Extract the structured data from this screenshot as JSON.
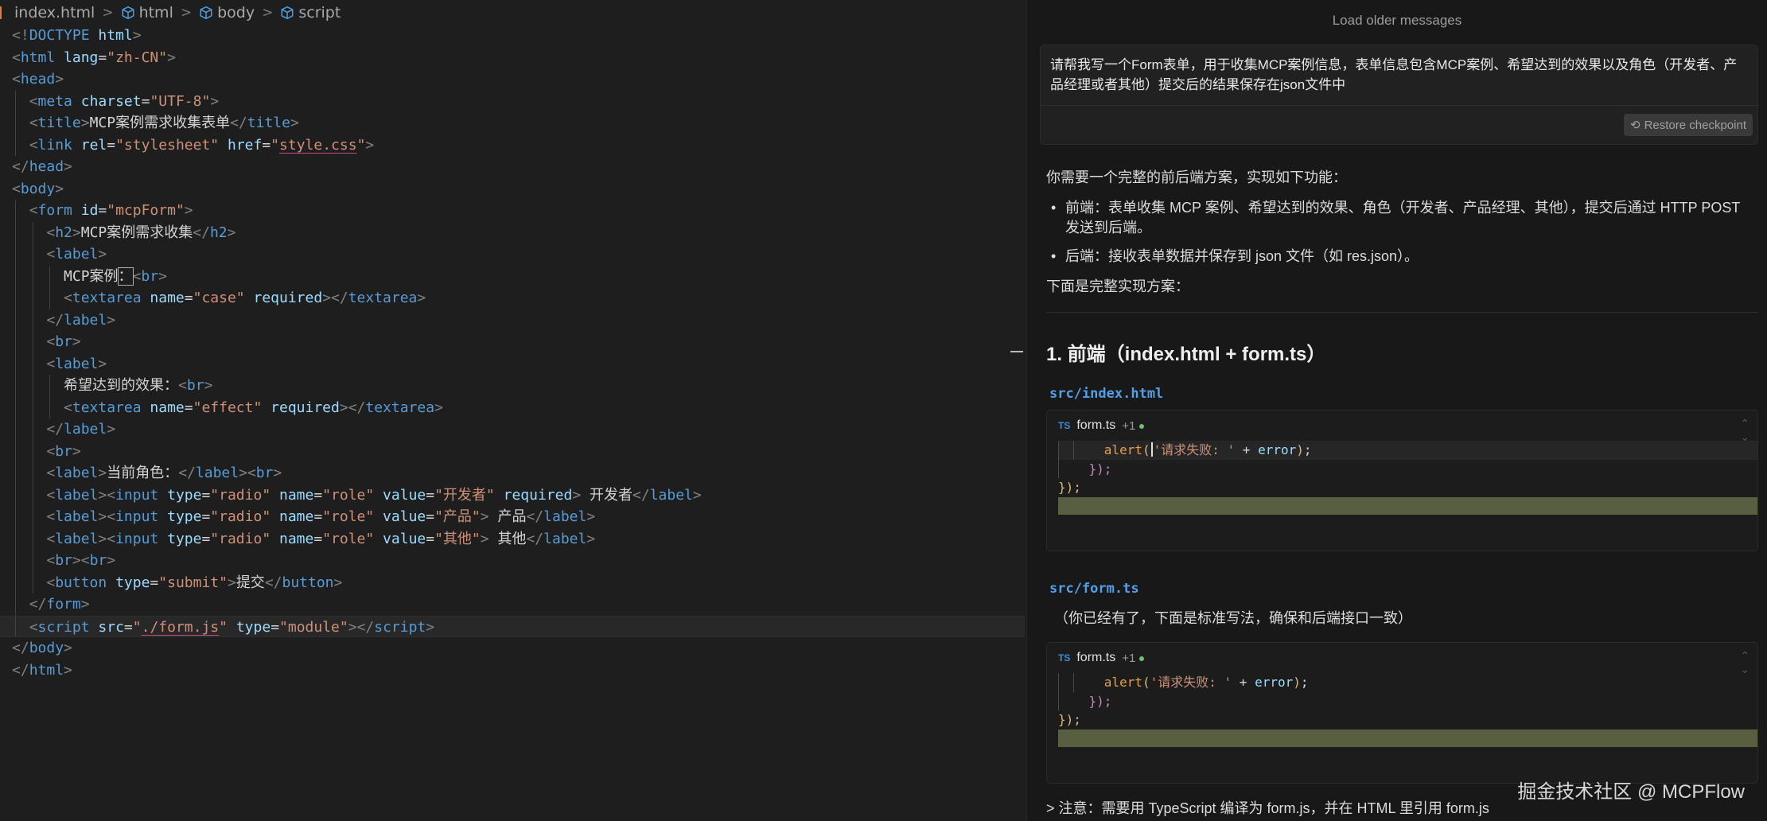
{
  "editor": {
    "breadcrumb": {
      "file": "index.html",
      "items": [
        "html",
        "body",
        "script"
      ]
    },
    "code_lines": [
      [
        {
          "c": "p",
          "t": "<!"
        },
        {
          "c": "t",
          "t": "DOCTYPE"
        },
        {
          "c": "a",
          "t": " html"
        },
        {
          "c": "p",
          "t": ">"
        }
      ],
      [
        {
          "c": "p",
          "t": "<"
        },
        {
          "c": "t",
          "t": "html"
        },
        {
          "c": "a",
          "t": " lang"
        },
        {
          "c": "tx",
          "t": "="
        },
        {
          "c": "s",
          "t": "\"zh-CN\""
        },
        {
          "c": "p",
          "t": ">"
        }
      ],
      [
        {
          "c": "p",
          "t": "<"
        },
        {
          "c": "t",
          "t": "head"
        },
        {
          "c": "p",
          "t": ">"
        }
      ],
      [
        {
          "c": "tx",
          "t": "  "
        },
        {
          "c": "p",
          "t": "<"
        },
        {
          "c": "t",
          "t": "meta"
        },
        {
          "c": "a",
          "t": " charset"
        },
        {
          "c": "tx",
          "t": "="
        },
        {
          "c": "s",
          "t": "\"UTF-8\""
        },
        {
          "c": "p",
          "t": ">"
        }
      ],
      [
        {
          "c": "tx",
          "t": "  "
        },
        {
          "c": "p",
          "t": "<"
        },
        {
          "c": "t",
          "t": "title"
        },
        {
          "c": "p",
          "t": ">"
        },
        {
          "c": "tx",
          "t": "MCP案例需求收集表单"
        },
        {
          "c": "p",
          "t": "</"
        },
        {
          "c": "t",
          "t": "title"
        },
        {
          "c": "p",
          "t": ">"
        }
      ],
      [
        {
          "c": "tx",
          "t": "  "
        },
        {
          "c": "p",
          "t": "<"
        },
        {
          "c": "t",
          "t": "link"
        },
        {
          "c": "a",
          "t": " rel"
        },
        {
          "c": "tx",
          "t": "="
        },
        {
          "c": "s",
          "t": "\"stylesheet\""
        },
        {
          "c": "a",
          "t": " href"
        },
        {
          "c": "tx",
          "t": "="
        },
        {
          "c": "s",
          "t": "\""
        },
        {
          "c": "s u",
          "t": "style.css"
        },
        {
          "c": "s",
          "t": "\""
        },
        {
          "c": "p",
          "t": ">"
        }
      ],
      [
        {
          "c": "p",
          "t": "</"
        },
        {
          "c": "t",
          "t": "head"
        },
        {
          "c": "p",
          "t": ">"
        }
      ],
      [
        {
          "c": "p",
          "t": "<"
        },
        {
          "c": "t",
          "t": "body"
        },
        {
          "c": "p",
          "t": ">"
        }
      ],
      [
        {
          "c": "tx",
          "t": "  "
        },
        {
          "c": "p",
          "t": "<"
        },
        {
          "c": "t",
          "t": "form"
        },
        {
          "c": "a",
          "t": " id"
        },
        {
          "c": "tx",
          "t": "="
        },
        {
          "c": "s",
          "t": "\"mcpForm\""
        },
        {
          "c": "p",
          "t": ">"
        }
      ],
      [
        {
          "c": "tx",
          "t": "    "
        },
        {
          "c": "p",
          "t": "<"
        },
        {
          "c": "t",
          "t": "h2"
        },
        {
          "c": "p",
          "t": ">"
        },
        {
          "c": "tx",
          "t": "MCP案例需求收集"
        },
        {
          "c": "p",
          "t": "</"
        },
        {
          "c": "t",
          "t": "h2"
        },
        {
          "c": "p",
          "t": ">"
        }
      ],
      [
        {
          "c": "tx",
          "t": "    "
        },
        {
          "c": "p",
          "t": "<"
        },
        {
          "c": "t",
          "t": "label"
        },
        {
          "c": "p",
          "t": ">"
        }
      ],
      [
        {
          "c": "tx",
          "t": "      MCP案例"
        },
        {
          "c": "tx cursorbox",
          "t": "："
        },
        {
          "c": "p",
          "t": "<"
        },
        {
          "c": "t",
          "t": "br"
        },
        {
          "c": "p",
          "t": ">"
        }
      ],
      [
        {
          "c": "tx",
          "t": "      "
        },
        {
          "c": "p",
          "t": "<"
        },
        {
          "c": "t",
          "t": "textarea"
        },
        {
          "c": "a",
          "t": " name"
        },
        {
          "c": "tx",
          "t": "="
        },
        {
          "c": "s",
          "t": "\"case\""
        },
        {
          "c": "a",
          "t": " required"
        },
        {
          "c": "p",
          "t": "></"
        },
        {
          "c": "t",
          "t": "textarea"
        },
        {
          "c": "p",
          "t": ">"
        }
      ],
      [
        {
          "c": "tx",
          "t": "    "
        },
        {
          "c": "p",
          "t": "</"
        },
        {
          "c": "t",
          "t": "label"
        },
        {
          "c": "p",
          "t": ">"
        }
      ],
      [
        {
          "c": "tx",
          "t": "    "
        },
        {
          "c": "p",
          "t": "<"
        },
        {
          "c": "t",
          "t": "br"
        },
        {
          "c": "p",
          "t": ">"
        }
      ],
      [
        {
          "c": "tx",
          "t": "    "
        },
        {
          "c": "p",
          "t": "<"
        },
        {
          "c": "t",
          "t": "label"
        },
        {
          "c": "p",
          "t": ">"
        }
      ],
      [
        {
          "c": "tx",
          "t": "      希望达到的效果："
        },
        {
          "c": "p",
          "t": "<"
        },
        {
          "c": "t",
          "t": "br"
        },
        {
          "c": "p",
          "t": ">"
        }
      ],
      [
        {
          "c": "tx",
          "t": "      "
        },
        {
          "c": "p",
          "t": "<"
        },
        {
          "c": "t",
          "t": "textarea"
        },
        {
          "c": "a",
          "t": " name"
        },
        {
          "c": "tx",
          "t": "="
        },
        {
          "c": "s",
          "t": "\"effect\""
        },
        {
          "c": "a",
          "t": " required"
        },
        {
          "c": "p",
          "t": "></"
        },
        {
          "c": "t",
          "t": "textarea"
        },
        {
          "c": "p",
          "t": ">"
        }
      ],
      [
        {
          "c": "tx",
          "t": "    "
        },
        {
          "c": "p",
          "t": "</"
        },
        {
          "c": "t",
          "t": "label"
        },
        {
          "c": "p",
          "t": ">"
        }
      ],
      [
        {
          "c": "tx",
          "t": "    "
        },
        {
          "c": "p",
          "t": "<"
        },
        {
          "c": "t",
          "t": "br"
        },
        {
          "c": "p",
          "t": ">"
        }
      ],
      [
        {
          "c": "tx",
          "t": "    "
        },
        {
          "c": "p",
          "t": "<"
        },
        {
          "c": "t",
          "t": "label"
        },
        {
          "c": "p",
          "t": ">"
        },
        {
          "c": "tx",
          "t": "当前角色："
        },
        {
          "c": "p",
          "t": "</"
        },
        {
          "c": "t",
          "t": "label"
        },
        {
          "c": "p",
          "t": "><"
        },
        {
          "c": "t",
          "t": "br"
        },
        {
          "c": "p",
          "t": ">"
        }
      ],
      [
        {
          "c": "tx",
          "t": "    "
        },
        {
          "c": "p",
          "t": "<"
        },
        {
          "c": "t",
          "t": "label"
        },
        {
          "c": "p",
          "t": "><"
        },
        {
          "c": "t",
          "t": "input"
        },
        {
          "c": "a",
          "t": " type"
        },
        {
          "c": "tx",
          "t": "="
        },
        {
          "c": "s",
          "t": "\"radio\""
        },
        {
          "c": "a",
          "t": " name"
        },
        {
          "c": "tx",
          "t": "="
        },
        {
          "c": "s",
          "t": "\"role\""
        },
        {
          "c": "a",
          "t": " value"
        },
        {
          "c": "tx",
          "t": "="
        },
        {
          "c": "s",
          "t": "\"开发者\""
        },
        {
          "c": "a",
          "t": " required"
        },
        {
          "c": "p",
          "t": ">"
        },
        {
          "c": "tx",
          "t": " 开发者"
        },
        {
          "c": "p",
          "t": "</"
        },
        {
          "c": "t",
          "t": "label"
        },
        {
          "c": "p",
          "t": ">"
        }
      ],
      [
        {
          "c": "tx",
          "t": "    "
        },
        {
          "c": "p",
          "t": "<"
        },
        {
          "c": "t",
          "t": "label"
        },
        {
          "c": "p",
          "t": "><"
        },
        {
          "c": "t",
          "t": "input"
        },
        {
          "c": "a",
          "t": " type"
        },
        {
          "c": "tx",
          "t": "="
        },
        {
          "c": "s",
          "t": "\"radio\""
        },
        {
          "c": "a",
          "t": " name"
        },
        {
          "c": "tx",
          "t": "="
        },
        {
          "c": "s",
          "t": "\"role\""
        },
        {
          "c": "a",
          "t": " value"
        },
        {
          "c": "tx",
          "t": "="
        },
        {
          "c": "s",
          "t": "\"产品\""
        },
        {
          "c": "p",
          "t": ">"
        },
        {
          "c": "tx",
          "t": " 产品"
        },
        {
          "c": "p",
          "t": "</"
        },
        {
          "c": "t",
          "t": "label"
        },
        {
          "c": "p",
          "t": ">"
        }
      ],
      [
        {
          "c": "tx",
          "t": "    "
        },
        {
          "c": "p",
          "t": "<"
        },
        {
          "c": "t",
          "t": "label"
        },
        {
          "c": "p",
          "t": "><"
        },
        {
          "c": "t",
          "t": "input"
        },
        {
          "c": "a",
          "t": " type"
        },
        {
          "c": "tx",
          "t": "="
        },
        {
          "c": "s",
          "t": "\"radio\""
        },
        {
          "c": "a",
          "t": " name"
        },
        {
          "c": "tx",
          "t": "="
        },
        {
          "c": "s",
          "t": "\"role\""
        },
        {
          "c": "a",
          "t": " value"
        },
        {
          "c": "tx",
          "t": "="
        },
        {
          "c": "s",
          "t": "\"其他\""
        },
        {
          "c": "p",
          "t": ">"
        },
        {
          "c": "tx",
          "t": " 其他"
        },
        {
          "c": "p",
          "t": "</"
        },
        {
          "c": "t",
          "t": "label"
        },
        {
          "c": "p",
          "t": ">"
        }
      ],
      [
        {
          "c": "tx",
          "t": "    "
        },
        {
          "c": "p",
          "t": "<"
        },
        {
          "c": "t",
          "t": "br"
        },
        {
          "c": "p",
          "t": "><"
        },
        {
          "c": "t",
          "t": "br"
        },
        {
          "c": "p",
          "t": ">"
        }
      ],
      [
        {
          "c": "tx",
          "t": "    "
        },
        {
          "c": "p",
          "t": "<"
        },
        {
          "c": "t",
          "t": "button"
        },
        {
          "c": "a",
          "t": " type"
        },
        {
          "c": "tx",
          "t": "="
        },
        {
          "c": "s",
          "t": "\"submit\""
        },
        {
          "c": "p",
          "t": ">"
        },
        {
          "c": "tx",
          "t": "提交"
        },
        {
          "c": "p",
          "t": "</"
        },
        {
          "c": "t",
          "t": "button"
        },
        {
          "c": "p",
          "t": ">"
        }
      ],
      [
        {
          "c": "tx",
          "t": "  "
        },
        {
          "c": "p",
          "t": "</"
        },
        {
          "c": "t",
          "t": "form"
        },
        {
          "c": "p",
          "t": ">"
        }
      ],
      [
        {
          "c": "tx",
          "t": "  "
        },
        {
          "c": "p",
          "t": "<"
        },
        {
          "c": "t",
          "t": "script"
        },
        {
          "c": "a",
          "t": " src"
        },
        {
          "c": "tx",
          "t": "="
        },
        {
          "c": "s",
          "t": "\""
        },
        {
          "c": "s u",
          "t": "./form.js"
        },
        {
          "c": "s",
          "t": "\""
        },
        {
          "c": "a",
          "t": " type"
        },
        {
          "c": "tx",
          "t": "="
        },
        {
          "c": "s",
          "t": "\"module\""
        },
        {
          "c": "p",
          "t": "></"
        },
        {
          "c": "t",
          "t": "script"
        },
        {
          "c": "p",
          "t": ">"
        }
      ],
      [
        {
          "c": "p",
          "t": "</"
        },
        {
          "c": "t",
          "t": "body"
        },
        {
          "c": "p",
          "t": ">"
        }
      ],
      [
        {
          "c": "p",
          "t": "</"
        },
        {
          "c": "t",
          "t": "html"
        },
        {
          "c": "p",
          "t": ">"
        }
      ]
    ]
  },
  "chat": {
    "load_older": "Load older messages",
    "user_message": "请帮我写一个Form表单，用于收集MCP案例信息，表单信息包含MCP案例、希望达到的效果以及角色（开发者、产品经理或者其他）提交后的结果保存在json文件中",
    "restore_checkpoint": "Restore checkpoint",
    "intro": "你需要一个完整的前后端方案，实现如下功能：",
    "bullets": [
      "前端：表单收集 MCP 案例、希望达到的效果、角色（开发者、产品经理、其他），提交后通过 HTTP POST 发送到后端。",
      "后端：接收表单数据并保存到 json 文件（如 res.json）。"
    ],
    "lead": "下面是完整实现方案：",
    "heading": "1. 前端（index.html + form.ts）",
    "path1": "src/index.html",
    "path2": "src/form.ts",
    "note_existing": "（你已经有了，下面是标准写法，确保和后端接口一致）",
    "card": {
      "ts_label": "TS",
      "filename": "form.ts",
      "badge": "+1",
      "alert_fn": "alert",
      "alert_str": "'请求失败: '",
      "alert_op": " + ",
      "alert_var": "error",
      "close1": "});",
      "close2": "});"
    },
    "bottom_note": "> 注意：需要用 TypeScript 编译为 form.js，并在 HTML 里引用 form.js"
  },
  "watermark": "掘金技术社区 @ MCPFlow"
}
